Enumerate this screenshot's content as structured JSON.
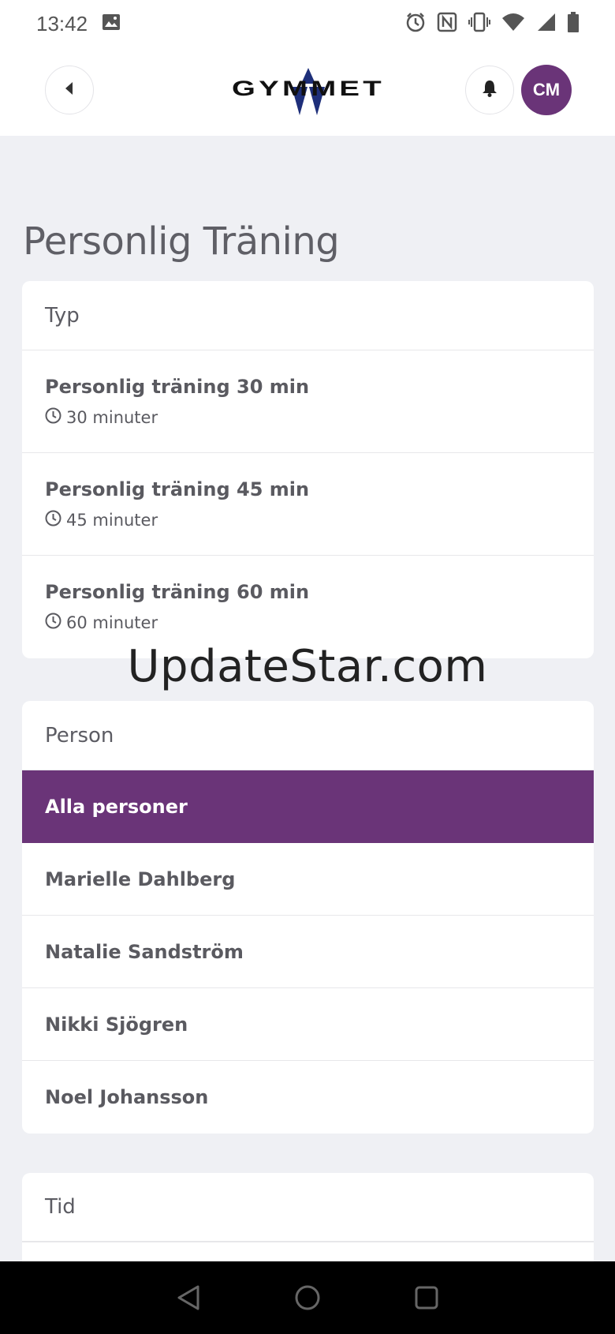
{
  "status_bar": {
    "time": "13:42"
  },
  "header": {
    "logo_text": "GYMMET",
    "avatar_initials": "CM"
  },
  "page": {
    "title": "Personlig Träning"
  },
  "type_card": {
    "header": "Typ",
    "items": [
      {
        "name": "Personlig träning 30 min",
        "duration": "30 minuter"
      },
      {
        "name": "Personlig träning 45 min",
        "duration": "45 minuter"
      },
      {
        "name": "Personlig träning 60 min",
        "duration": "60 minuter"
      }
    ]
  },
  "person_card": {
    "header": "Person",
    "items": [
      {
        "name": "Alla personer",
        "selected": true
      },
      {
        "name": "Marielle Dahlberg"
      },
      {
        "name": "Natalie Sandström"
      },
      {
        "name": "Nikki Sjögren"
      },
      {
        "name": "Noel Johansson"
      }
    ]
  },
  "time_card": {
    "header": "Tid"
  },
  "watermark": "UpdateStar.com",
  "colors": {
    "accent": "#6a3478",
    "background": "#eff0f4"
  }
}
